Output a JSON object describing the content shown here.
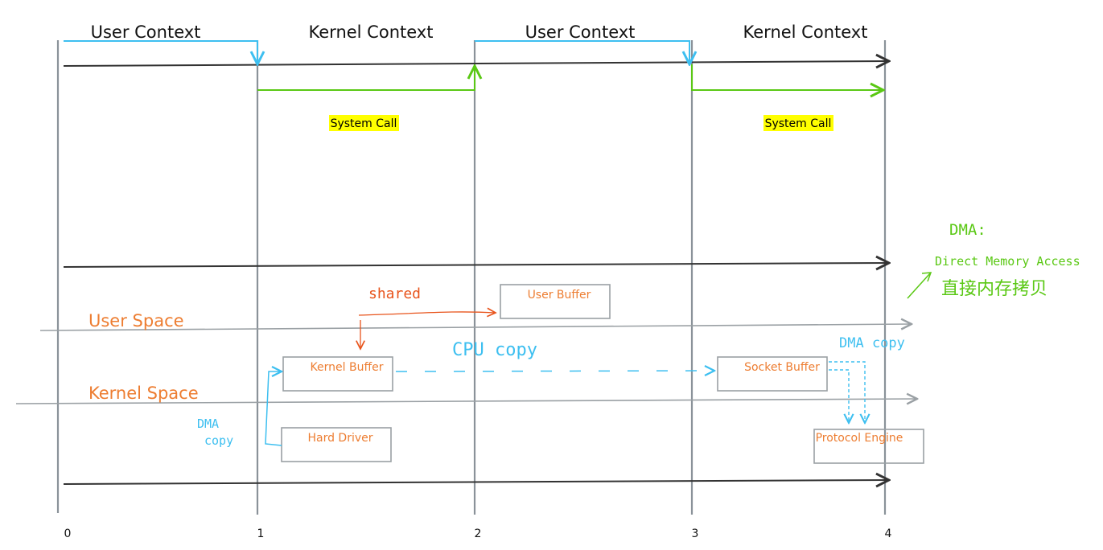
{
  "contexts": [
    "User Context",
    "Kernel Context",
    "User Context",
    "Kernel Context"
  ],
  "system_call_labels": [
    "System Call",
    "System Call"
  ],
  "spaces": {
    "user": "User Space",
    "kernel": "Kernel Space"
  },
  "boxes": {
    "user_buffer": "User Buffer",
    "kernel_buffer": "Kernel Buffer",
    "socket_buffer": "Socket Buffer",
    "hard_driver": "Hard Driver",
    "protocol_engine": "Protocol Engine"
  },
  "annotations": {
    "shared": "shared",
    "cpu_copy": "CPU copy",
    "dma_copy_left_1": "DMA",
    "dma_copy_left_2": "copy",
    "dma_copy_right": "DMA copy",
    "dma_title": "DMA:",
    "dma_full": "Direct Memory Access",
    "dma_chinese": "直接内存拷贝"
  },
  "ticks": [
    "0",
    "1",
    "2",
    "3",
    "4"
  ],
  "colors": {
    "cyan": "#3dbff0",
    "green": "#5ac814",
    "orange": "#ed7d31",
    "highlight": "#ffff00",
    "gridline": "#8a9299"
  }
}
